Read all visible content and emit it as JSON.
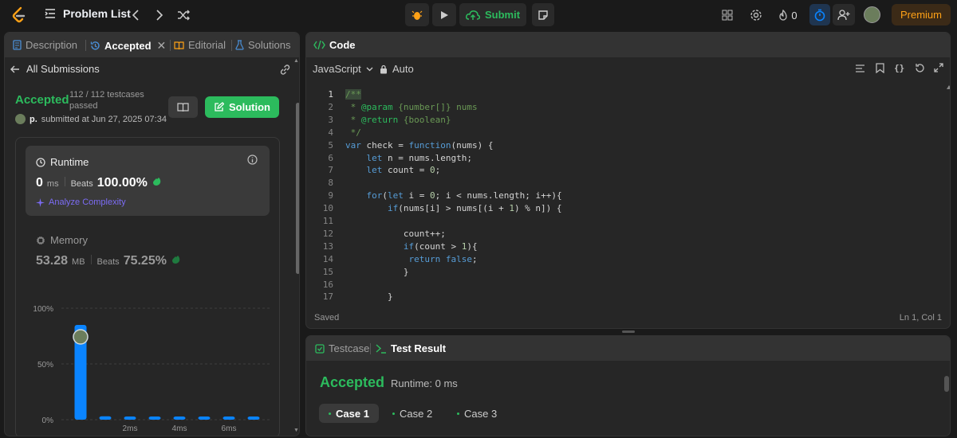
{
  "topbar": {
    "title": "Problem List",
    "submit": "Submit",
    "streak": "0",
    "premium": "Premium"
  },
  "left_tabs": {
    "description": "Description",
    "accepted": "Accepted",
    "editorial": "Editorial",
    "solutions": "Solutions"
  },
  "back": {
    "label": "All Submissions"
  },
  "result": {
    "status": "Accepted",
    "testcases": "112 / 112 testcases",
    "passed": "passed",
    "user": "p.",
    "submitted": "submitted at Jun 27, 2025 07:34",
    "solution_btn": "Solution"
  },
  "runtime": {
    "label": "Runtime",
    "value": "0",
    "unit": "ms",
    "beats_label": "Beats",
    "beats": "100.00%",
    "analyze": "Analyze Complexity"
  },
  "memory": {
    "label": "Memory",
    "value": "53.28",
    "unit": "MB",
    "beats_label": "Beats",
    "beats": "75.25%"
  },
  "histogram": {
    "y_labels": [
      "100%",
      "50%",
      "0%"
    ],
    "x_labels": [
      "2ms",
      "4ms",
      "6ms"
    ]
  },
  "chart_data": {
    "type": "bar",
    "categories": [
      "0ms",
      "1ms",
      "2ms",
      "3ms",
      "4ms",
      "5ms",
      "6ms",
      "7ms"
    ],
    "values": [
      85,
      3,
      2,
      2,
      2,
      2,
      2,
      2
    ],
    "ylim": [
      0,
      100
    ],
    "ylabel": "",
    "xlabel": ""
  },
  "code": {
    "title": "Code",
    "language": "JavaScript",
    "auto": "Auto",
    "lines": [
      {
        "n": "1",
        "t": "/**"
      },
      {
        "n": "2",
        "t": " * @param {number[]} nums"
      },
      {
        "n": "3",
        "t": " * @return {boolean}"
      },
      {
        "n": "4",
        "t": " */"
      },
      {
        "n": "5",
        "t": "var check = function(nums) {"
      },
      {
        "n": "6",
        "t": "    let n = nums.length;"
      },
      {
        "n": "7",
        "t": "    let count = 0;"
      },
      {
        "n": "8",
        "t": ""
      },
      {
        "n": "9",
        "t": "    for(let i = 0; i < nums.length; i++){"
      },
      {
        "n": "10",
        "t": "        if(nums[i] > nums[(i + 1) % n]) {"
      },
      {
        "n": "11",
        "t": ""
      },
      {
        "n": "12",
        "t": "           count++;"
      },
      {
        "n": "13",
        "t": "           if(count > 1){"
      },
      {
        "n": "14",
        "t": "            return false;"
      },
      {
        "n": "15",
        "t": "           }"
      },
      {
        "n": "16",
        "t": ""
      },
      {
        "n": "17",
        "t": "        }"
      }
    ],
    "status_left": "Saved",
    "status_right": "Ln 1, Col 1"
  },
  "test": {
    "tab_testcase": "Testcase",
    "tab_result": "Test Result",
    "status": "Accepted",
    "runtime": "Runtime: 0 ms",
    "cases": [
      "Case 1",
      "Case 2",
      "Case 3"
    ]
  },
  "colors": {
    "accent": "#2cbb5d",
    "blue": "#0a84ff",
    "premium": "#ffa116"
  }
}
